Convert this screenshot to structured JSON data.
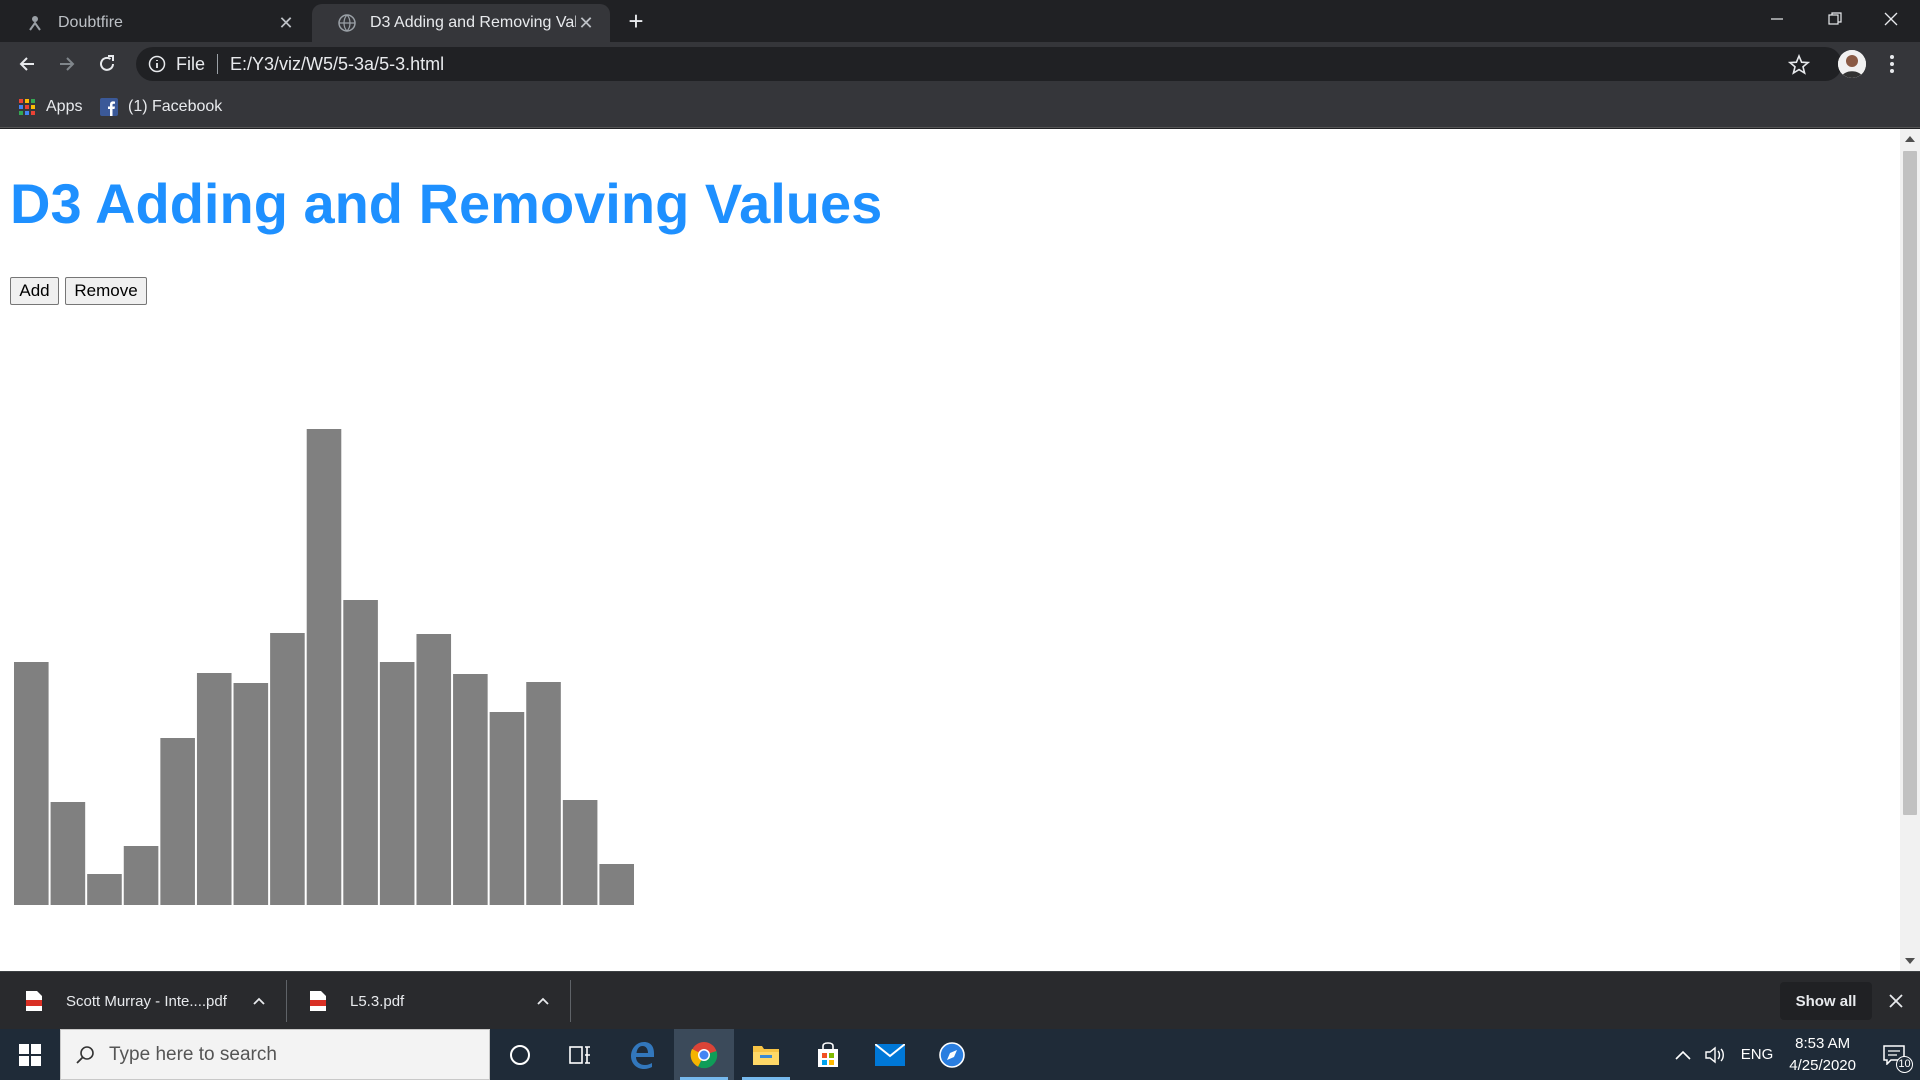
{
  "browser": {
    "tabs": [
      {
        "title": "Doubtfire",
        "active": false
      },
      {
        "title": "D3 Adding and Removing Values",
        "active": true
      }
    ],
    "address": {
      "scheme": "File",
      "url": "E:/Y3/viz/W5/5-3a/5-3.html"
    },
    "bookmarks": [
      {
        "label": "Apps"
      },
      {
        "label": "(1) Facebook"
      }
    ]
  },
  "page": {
    "title": "D3 Adding and Removing Values",
    "buttons": {
      "add": "Add",
      "remove": "Remove"
    }
  },
  "chart_data": {
    "type": "bar",
    "values": [
      243,
      103,
      31,
      59,
      167,
      232,
      222,
      272,
      476,
      305,
      243,
      271,
      231,
      193,
      223,
      105,
      41
    ],
    "ylim": [
      0,
      476
    ],
    "bar_color": "#808080",
    "title": "",
    "xlabel": "",
    "ylabel": ""
  },
  "downloads": {
    "items": [
      {
        "name": "Scott Murray - Inte....pdf"
      },
      {
        "name": "L5.3.pdf"
      }
    ],
    "show_all": "Show all"
  },
  "taskbar": {
    "search_placeholder": "Type here to search",
    "language": "ENG",
    "time": "8:53 AM",
    "date": "4/25/2020",
    "notifications": "10"
  },
  "colors": {
    "title_blue": "#1e90ff",
    "chrome_dark": "#202124",
    "chrome_toolbar": "#35363a",
    "taskbar": "#1f2b38"
  }
}
